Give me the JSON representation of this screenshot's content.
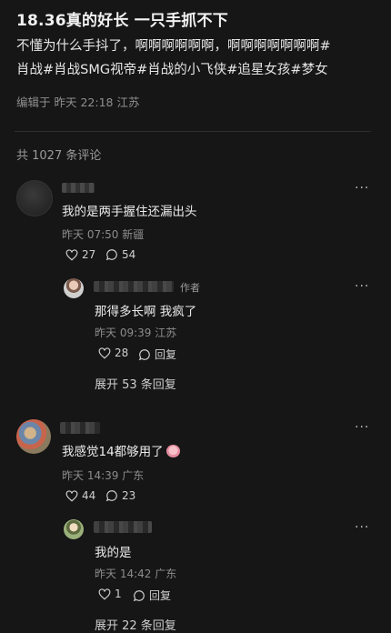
{
  "post": {
    "title": "18.36真的好长 一只手抓不下",
    "body_line1": "不懂为什么手抖了，啊啊啊啊啊啊，啊啊啊啊啊啊啊#",
    "tags": [
      "肖战",
      "#肖战SMG视帝",
      "#肖战的小飞侠",
      "#追星女孩",
      "#梦女"
    ],
    "meta": "编辑于 昨天 22:18 江苏"
  },
  "comments_count": "共 1027 条评论",
  "comments": [
    {
      "text": "我的是两手握住还漏出头",
      "meta": "昨天 07:50 新疆",
      "likes": "27",
      "replies_count": "54",
      "reply": {
        "author_tag": "作者",
        "text": "那得多长啊 我疯了",
        "meta": "昨天 09:39 江苏",
        "likes": "28",
        "reply_label": "回复"
      },
      "expand": "展开 53 条回复"
    },
    {
      "text": "我感觉14都够用了",
      "meta": "昨天 14:39 广东",
      "likes": "44",
      "replies_count": "23",
      "reply": {
        "text": "我的是",
        "meta": "昨天 14:42 广东",
        "likes": "1",
        "reply_label": "回复"
      },
      "expand": "展开 22 条回复"
    }
  ],
  "icons": {
    "more": "more-icon",
    "like": "heart-icon",
    "comment": "comment-bubble-icon"
  }
}
